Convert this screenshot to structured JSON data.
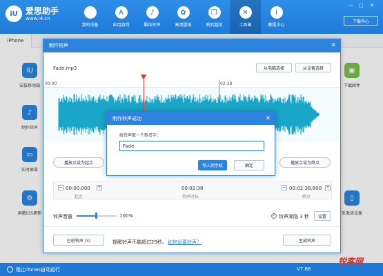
{
  "app": {
    "logo_badge": "iU",
    "name": "爱思助手",
    "url": "www.i4.cn",
    "download_label": "下载中心",
    "win_controls": [
      "—",
      "□",
      "✕"
    ]
  },
  "nav": [
    {
      "label": "我的设备",
      "icon": "apple-icon",
      "glyph": ""
    },
    {
      "label": "应用游戏",
      "icon": "app-store-icon",
      "glyph": "A"
    },
    {
      "label": "酷炫铃声",
      "icon": "bell-icon",
      "glyph": "♪"
    },
    {
      "label": "高清壁纸",
      "icon": "flower-icon",
      "glyph": "✿"
    },
    {
      "label": "刷机越狱",
      "icon": "box-icon",
      "glyph": "❒"
    },
    {
      "label": "工具箱",
      "icon": "tools-icon",
      "glyph": "✕",
      "active": true
    },
    {
      "label": "教程中心",
      "icon": "info-icon",
      "glyph": "i"
    }
  ],
  "device_tab": "iPhone",
  "bg_tiles": [
    {
      "label": "安装移动端",
      "glyph": "iU"
    },
    {
      "label": "制作铃声",
      "glyph": "♪"
    },
    {
      "label": "实时屏幕",
      "glyph": "▭"
    },
    {
      "label": "屏蔽iOS更新",
      "glyph": "⚙"
    },
    {
      "label": "下载固件",
      "glyph": "▣"
    },
    {
      "label": "反激活设备",
      "glyph": "▯"
    }
  ],
  "statusbar": {
    "itunes_label": "阻止iTunes自动运行",
    "version": "V7.68"
  },
  "watermark": "锐客网",
  "ringtone_dialog": {
    "title": "制作铃声",
    "close": "✕",
    "filename": "Fade.mp3",
    "from_computer": "从电脑选择",
    "from_device": "从设备选择",
    "timeline": {
      "start": "00:00",
      "mid": "02:38"
    },
    "play_from_start": "播放点设为起点",
    "play_as_end": "播放点设为终点",
    "start_time": "00:00.000",
    "start_caption": "起点",
    "duration": "00:02:38",
    "duration_caption": "铃声时长",
    "end_time": "00:02:38.600",
    "end_caption": "终点",
    "volume_label": "铃声音量",
    "volume_value": "100%",
    "volume_level": 0.5,
    "fade_label": "铃声渐隐 3 秒",
    "settings": "设置",
    "existing": "已创铃声 (3)",
    "note": "提醒铃声不能超过29秒。",
    "how_to": "如何设置铃声？",
    "generate": "生成铃声"
  },
  "success_dialog": {
    "title": "制作铃声成功",
    "close": "✕",
    "prompt": "给铃声取一个新名字：",
    "name_value": "Fade",
    "import": "导入到手机",
    "ok": "确定"
  },
  "colors": {
    "brand": "#1f7ad8",
    "wave": "#1aa6c8",
    "selection": "#29b36b",
    "playhead": "#e53935"
  }
}
